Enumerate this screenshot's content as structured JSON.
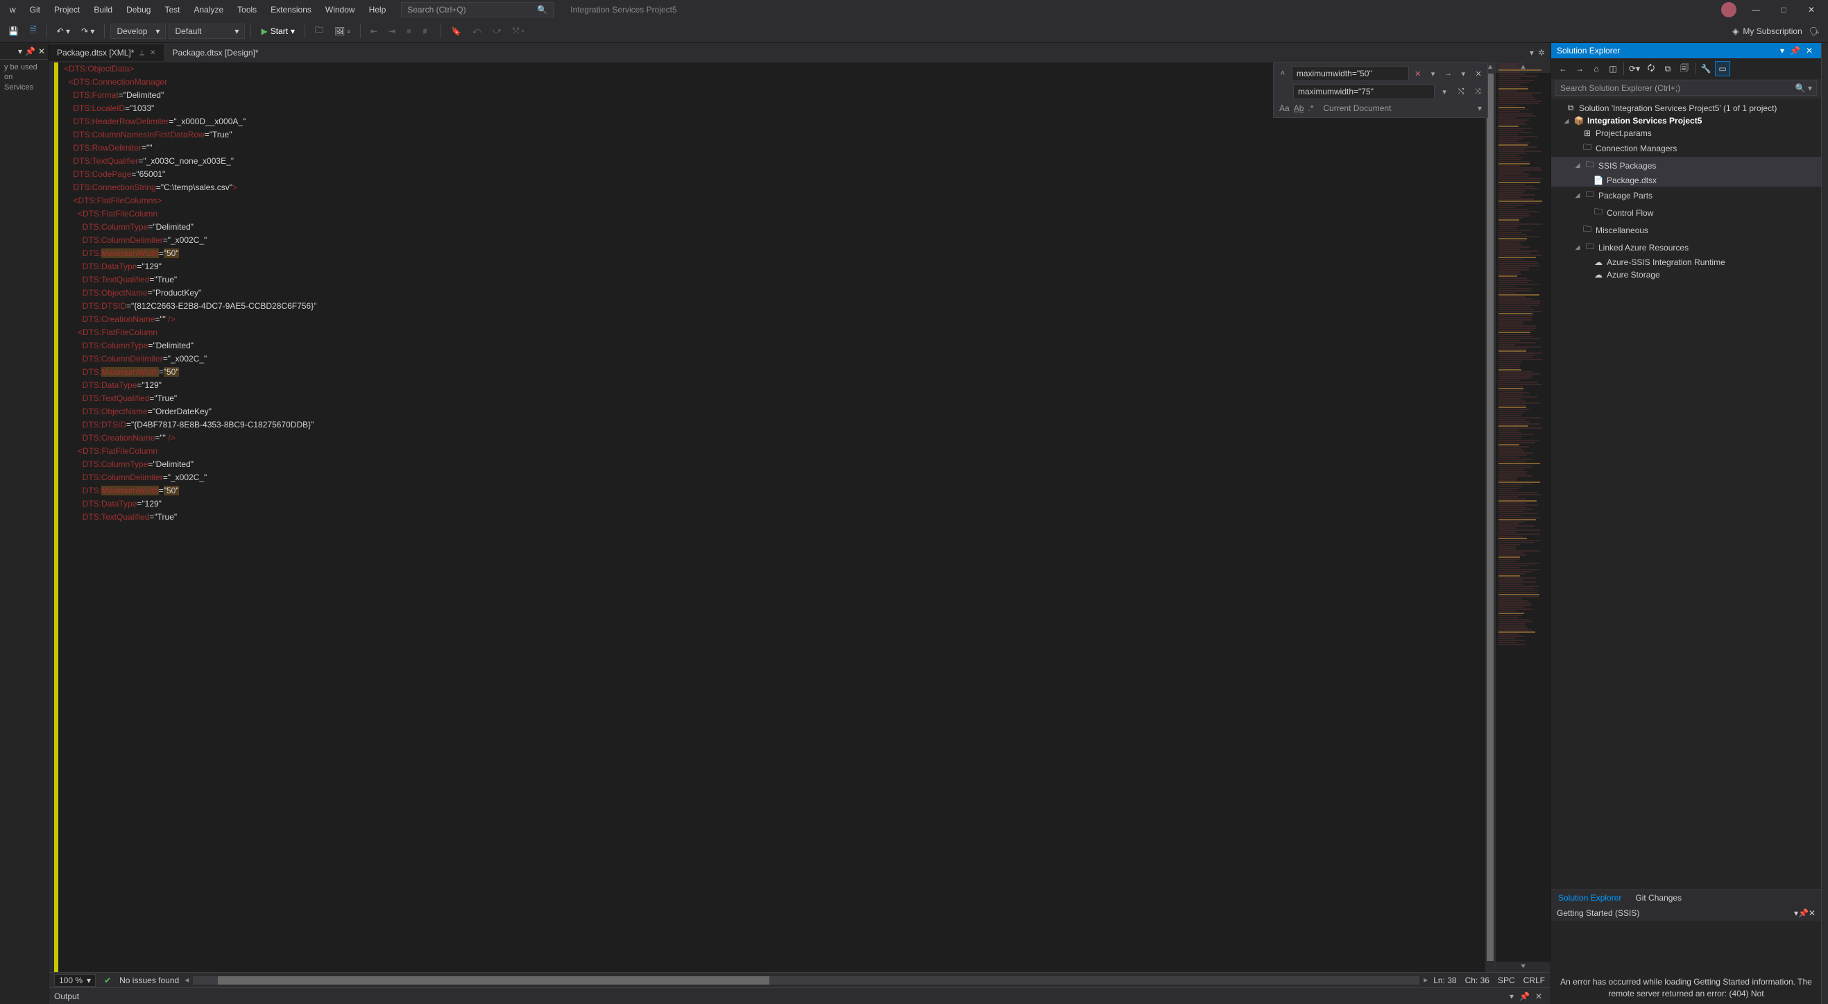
{
  "menu": {
    "items": [
      "w",
      "Git",
      "Project",
      "Build",
      "Debug",
      "Test",
      "Analyze",
      "Tools",
      "Extensions",
      "Window",
      "Help"
    ],
    "search_placeholder": "Search (Ctrl+Q)",
    "project_label": "Integration Services Project5"
  },
  "toolbar": {
    "branch": "Develop",
    "config": "Default",
    "start": "Start",
    "subscription": "My Subscription"
  },
  "leftdock": {
    "text": "y be used\non Services"
  },
  "tabs": {
    "active": "Package.dtsx [XML]*",
    "other": "Package.dtsx [Design]*"
  },
  "find": {
    "search": "maximumwidth=\"50\"",
    "replace": "maximumwidth=\"75\"",
    "scope": "Current Document"
  },
  "code_lines": [
    [
      [
        "xt",
        "<DTS:ObjectData>"
      ],
      [
        "xe",
        ""
      ]
    ],
    [
      [
        "xt",
        "  <DTS:ConnectionManager"
      ]
    ],
    [
      [
        "xt",
        "    DTS:Format"
      ],
      [
        "xe",
        "="
      ],
      [
        "xs",
        "\"Delimited\""
      ]
    ],
    [
      [
        "xt",
        "    DTS:LocaleID"
      ],
      [
        "xe",
        "="
      ],
      [
        "xs",
        "\"1033\""
      ]
    ],
    [
      [
        "xt",
        "    DTS:HeaderRowDelimiter"
      ],
      [
        "xe",
        "="
      ],
      [
        "xs",
        "\"_x000D__x000A_\""
      ]
    ],
    [
      [
        "xt",
        "    DTS:ColumnNamesInFirstDataRow"
      ],
      [
        "xe",
        "="
      ],
      [
        "xs",
        "\"True\""
      ]
    ],
    [
      [
        "xt",
        "    DTS:RowDelimiter"
      ],
      [
        "xe",
        "="
      ],
      [
        "xs",
        "\"\""
      ]
    ],
    [
      [
        "xt",
        "    DTS:TextQualifier"
      ],
      [
        "xe",
        "="
      ],
      [
        "xs",
        "\"_x003C_none_x003E_\""
      ]
    ],
    [
      [
        "xt",
        "    DTS:CodePage"
      ],
      [
        "xe",
        "="
      ],
      [
        "xs",
        "\"65001\""
      ]
    ],
    [
      [
        "xt",
        "    DTS:ConnectionString"
      ],
      [
        "xe",
        "="
      ],
      [
        "xs",
        "\"C:\\temp\\sales.csv\""
      ],
      [
        "xt",
        ">"
      ]
    ],
    [
      [
        "xt",
        "    <DTS:FlatFileColumns>"
      ]
    ],
    [
      [
        "xt",
        "      <DTS:FlatFileColumn"
      ]
    ],
    [
      [
        "xt",
        "        DTS:ColumnType"
      ],
      [
        "xe",
        "="
      ],
      [
        "xs",
        "\"Delimited\""
      ]
    ],
    [
      [
        "xt",
        "        DTS:ColumnDelimiter"
      ],
      [
        "xe",
        "="
      ],
      [
        "xs",
        "\"_x002C_\""
      ]
    ],
    [
      [
        "xt",
        "        DTS:"
      ],
      [
        "hl",
        "MaximumWidth"
      ],
      [
        "xe",
        "="
      ],
      [
        "hls",
        "\"50\""
      ]
    ],
    [
      [
        "xt",
        "        DTS:DataType"
      ],
      [
        "xe",
        "="
      ],
      [
        "xs",
        "\"129\""
      ]
    ],
    [
      [
        "xt",
        "        DTS:TextQualified"
      ],
      [
        "xe",
        "="
      ],
      [
        "xs",
        "\"True\""
      ]
    ],
    [
      [
        "xt",
        "        DTS:ObjectName"
      ],
      [
        "xe",
        "="
      ],
      [
        "xs",
        "\"ProductKey\""
      ]
    ],
    [
      [
        "xt",
        "        DTS:DTSID"
      ],
      [
        "xe",
        "="
      ],
      [
        "xs",
        "\"{812C2663-E2B8-4DC7-9AE5-CCBD28C6F756}\""
      ]
    ],
    [
      [
        "xt",
        "        DTS:CreationName"
      ],
      [
        "xe",
        "="
      ],
      [
        "xs",
        "\"\""
      ],
      [
        "xt",
        " />"
      ]
    ],
    [
      [
        "xt",
        "      <DTS:FlatFileColumn"
      ]
    ],
    [
      [
        "xt",
        "        DTS:ColumnType"
      ],
      [
        "xe",
        "="
      ],
      [
        "xs",
        "\"Delimited\""
      ]
    ],
    [
      [
        "xt",
        "        DTS:ColumnDelimiter"
      ],
      [
        "xe",
        "="
      ],
      [
        "xs",
        "\"_x002C_\""
      ]
    ],
    [
      [
        "xt",
        "        DTS:"
      ],
      [
        "hl",
        "MaximumWidth"
      ],
      [
        "xe",
        "="
      ],
      [
        "hls",
        "\"50\""
      ]
    ],
    [
      [
        "xt",
        "        DTS:DataType"
      ],
      [
        "xe",
        "="
      ],
      [
        "xs",
        "\"129\""
      ]
    ],
    [
      [
        "xt",
        "        DTS:TextQualified"
      ],
      [
        "xe",
        "="
      ],
      [
        "xs",
        "\"True\""
      ]
    ],
    [
      [
        "xt",
        "        DTS:ObjectName"
      ],
      [
        "xe",
        "="
      ],
      [
        "xs",
        "\"OrderDateKey\""
      ]
    ],
    [
      [
        "xt",
        "        DTS:DTSID"
      ],
      [
        "xe",
        "="
      ],
      [
        "xs",
        "\"{D4BF7817-8E8B-4353-8BC9-C18275670DDB}\""
      ]
    ],
    [
      [
        "xt",
        "        DTS:CreationName"
      ],
      [
        "xe",
        "="
      ],
      [
        "xs",
        "\"\""
      ],
      [
        "xt",
        " />"
      ]
    ],
    [
      [
        "xt",
        "      <DTS:FlatFileColumn"
      ]
    ],
    [
      [
        "xt",
        "        DTS:ColumnType"
      ],
      [
        "xe",
        "="
      ],
      [
        "xs",
        "\"Delimited\""
      ]
    ],
    [
      [
        "xt",
        "        DTS:ColumnDelimiter"
      ],
      [
        "xe",
        "="
      ],
      [
        "xs",
        "\"_x002C_\""
      ]
    ],
    [
      [
        "xt",
        "        DTS:"
      ],
      [
        "hl",
        "MaximumWidth"
      ],
      [
        "xe",
        "="
      ],
      [
        "hls",
        "\"50\""
      ]
    ],
    [
      [
        "xt",
        "        DTS:DataType"
      ],
      [
        "xe",
        "="
      ],
      [
        "xs",
        "\"129\""
      ]
    ],
    [
      [
        "xt",
        "        DTS:TextQualified"
      ],
      [
        "xe",
        "="
      ],
      [
        "xs",
        "\"True\""
      ]
    ]
  ],
  "status": {
    "zoom": "100 %",
    "issues": "No issues found",
    "ln": "Ln: 38",
    "ch": "Ch: 36",
    "enc": "SPC",
    "eol": "CRLF"
  },
  "output_title": "Output",
  "solution_explorer": {
    "title": "Solution Explorer",
    "search_placeholder": "Search Solution Explorer (Ctrl+;)",
    "sln": "Solution 'Integration Services Project5' (1 of 1 project)",
    "proj": "Integration Services Project5",
    "items": {
      "params": "Project.params",
      "cm": "Connection Managers",
      "pkgs": "SSIS Packages",
      "pkg": "Package.dtsx",
      "parts": "Package Parts",
      "cflow": "Control Flow",
      "misc": "Miscellaneous",
      "linked": "Linked Azure Resources",
      "azruntime": "Azure-SSIS Integration Runtime",
      "azstor": "Azure Storage"
    }
  },
  "bottom_tabs": {
    "se": "Solution Explorer",
    "git": "Git Changes"
  },
  "getting_started": {
    "title": "Getting Started (SSIS)",
    "error": "An error has occurred while loading Getting Started information. The remote server returned an error: (404) Not"
  }
}
